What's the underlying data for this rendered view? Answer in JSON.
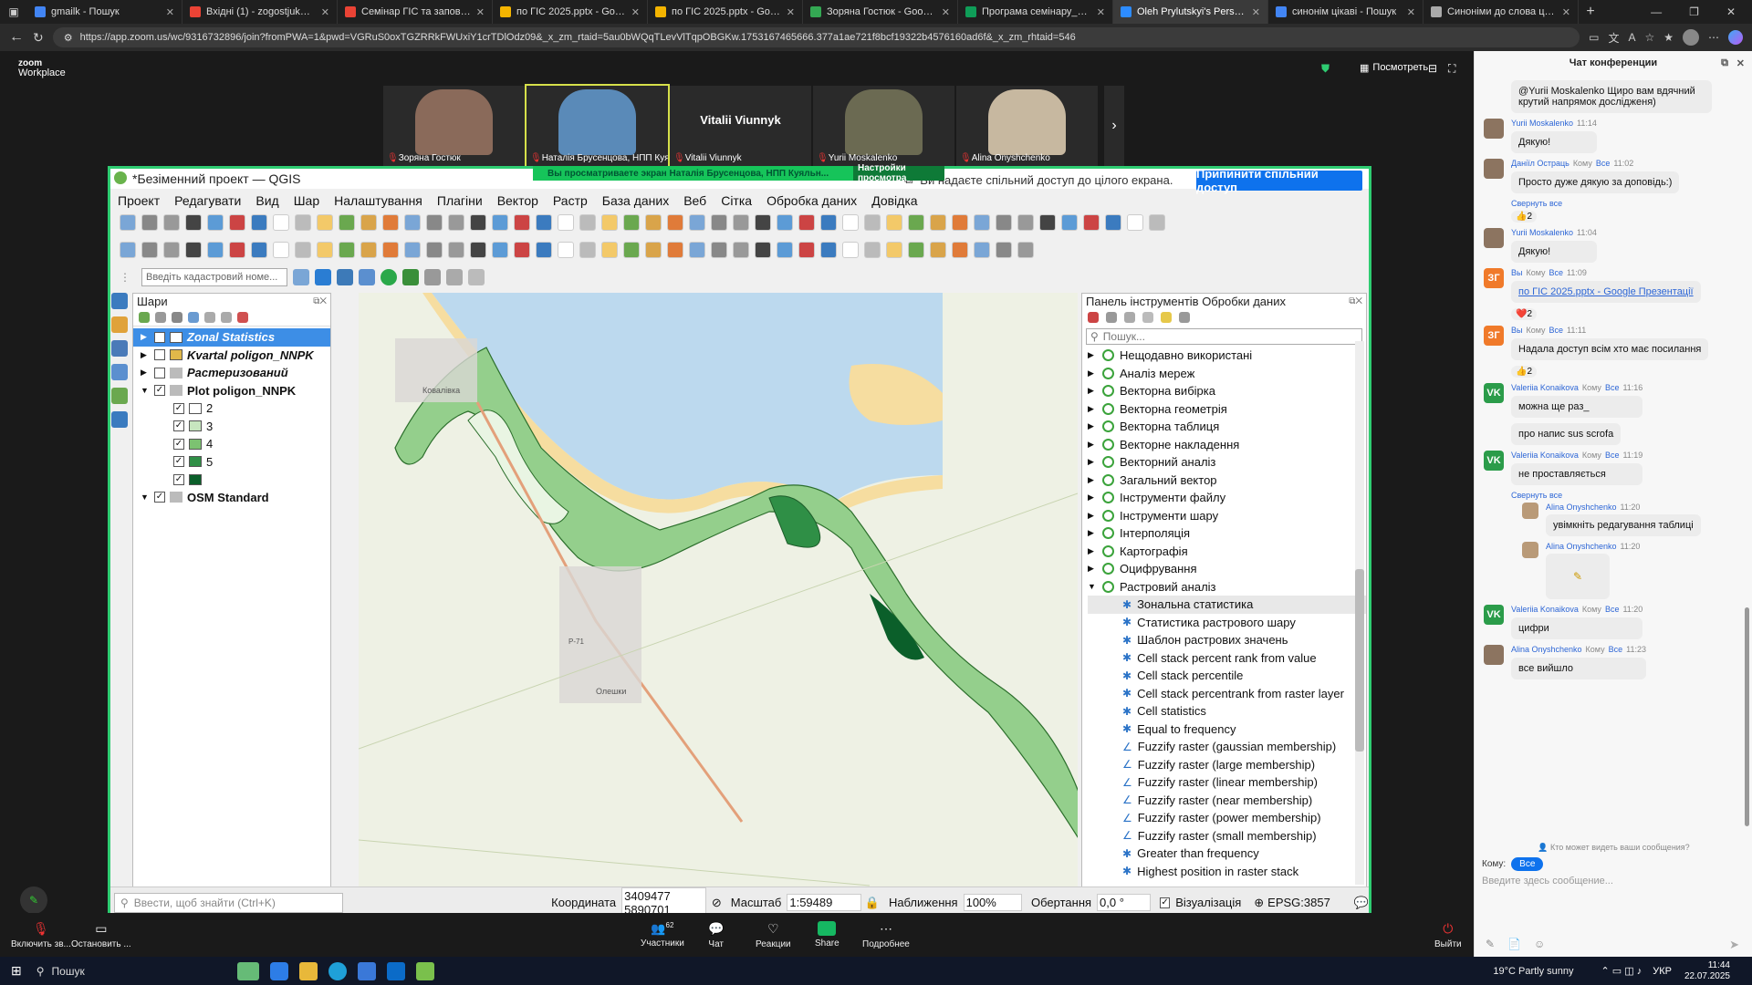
{
  "browser": {
    "tabs": [
      {
        "label": "gmailk - Пошук",
        "color": "#4285f4"
      },
      {
        "label": "Вхідні (1) - zogostjuk@gmail.co",
        "color": "#ea4335"
      },
      {
        "label": "Семінар ГІС та заповідні тери",
        "color": "#ea4335"
      },
      {
        "label": "по ГІС 2025.pptx - Google Пре",
        "color": "#f4b400"
      },
      {
        "label": "по ГІС 2025.pptx - Google Пре",
        "color": "#f4b400"
      },
      {
        "label": "Зоряна Гостюк - Google Диск",
        "color": "#34a853"
      },
      {
        "label": "Програма семінару_2025.xlsx",
        "color": "#0f9d58"
      },
      {
        "label": "Oleh Prylutskyi's Personal",
        "color": "#2d8cff",
        "active": true
      },
      {
        "label": "синонім цікаві - Пошук",
        "color": "#4285f4"
      },
      {
        "label": "Синоніми до слова цікавий в",
        "color": "#aaaaaa"
      }
    ],
    "url": "https://app.zoom.us/wc/9316732896/join?fromPWA=1&pwd=VGRuS0oxTGZRRkFWUxiY1crTDlOdz09&_x_zm_rtaid=5au0bWQqTLevVlTqpOBGKw.1753167465666.377a1ae721f8bcf19322b4576160ad6f&_x_zm_rhtaid=546"
  },
  "zoom": {
    "brand": [
      "zoom",
      "Workplace"
    ],
    "view_label": "Посмотреть",
    "participants": [
      {
        "name": "Зоряна Гостюк"
      },
      {
        "name": "Наталія Брусенцова, НПП Куяльн..."
      },
      {
        "name": "Vitalii Viunnyk",
        "center": "Vitalii Viunnyk"
      },
      {
        "name": "Yurii Moskalenko"
      },
      {
        "name": "Alina Onyshchenko"
      }
    ],
    "share_banner": "Вы просматриваете экран  Наталія Брусенцова, НПП Куяльн...",
    "share_settings": "Настройки просмотра",
    "screen_notice": "Ви надаєте спільний доступ до цілого екрана.",
    "stop_share": "Припинити спільний доступ",
    "bottom": {
      "mic": "Включить зв...",
      "video": "Остановить ...",
      "participants": "Участники",
      "participants_count": "62",
      "chat": "Чат",
      "reactions": "Реакции",
      "share": "Share",
      "more": "Подробнее",
      "leave": "Выйти"
    }
  },
  "qgis": {
    "title": "*Безіменний проект — QGIS",
    "menu": [
      "Проект",
      "Редагувати",
      "Вид",
      "Шар",
      "Налаштування",
      "Плагіни",
      "Вектор",
      "Растр",
      "База даних",
      "Веб",
      "Сітка",
      "Обробка даних",
      "Довідка"
    ],
    "cadastre_placeholder": "Введіть кадастровий номе...",
    "layers_title": "Шари",
    "layers": [
      {
        "name": "Zonal Statistics",
        "style": "bold-italic",
        "selected": true,
        "checked": false,
        "swatch": "#ffffff"
      },
      {
        "name": "Kvartal poligon_NNPK",
        "style": "bold-italic",
        "checked": false,
        "swatch": "#e0b84a"
      },
      {
        "name": "Растеризований",
        "style": "bold-italic",
        "checked": false,
        "swatch": ""
      },
      {
        "name": "Plot poligon_NNPK",
        "style": "bold",
        "checked": true,
        "swatch": ""
      },
      {
        "name": "2",
        "child": true,
        "checked": true,
        "swatch": "#ffffff"
      },
      {
        "name": "3",
        "child": true,
        "checked": true,
        "swatch": "#c7e6bf"
      },
      {
        "name": "4",
        "child": true,
        "checked": true,
        "swatch": "#7cc271"
      },
      {
        "name": "5",
        "child": true,
        "checked": true,
        "swatch": "#2f8f46"
      },
      {
        "name": "",
        "child": true,
        "checked": true,
        "swatch": "#0b5f2a"
      },
      {
        "name": "OSM Standard",
        "style": "bold",
        "checked": true,
        "swatch": ""
      }
    ],
    "processing_title": "Панель інструментів Обробки даних",
    "processing_search": "Пошук...",
    "groups": [
      "Нещодавно використані",
      "Аналіз мереж",
      "Векторна вибірка",
      "Векторна геометрія",
      "Векторна таблиця",
      "Векторне накладення",
      "Векторний аналіз",
      "Загальний вектор",
      "Інструменти файлу",
      "Інструменти шару",
      "Інтерполяція",
      "Картографія",
      "Оцифрування",
      "Растровий аналіз"
    ],
    "raster_tools": [
      "Зональна статистика",
      "Статистика растрового шару",
      "Шаблон растрових значень",
      "Cell stack percent rank from value",
      "Cell stack percentile",
      "Cell stack percentrank from raster layer",
      "Cell statistics",
      "Equal to frequency",
      "Fuzzify raster (gaussian membership)",
      "Fuzzify raster (large membership)",
      "Fuzzify raster (linear membership)",
      "Fuzzify raster (near membership)",
      "Fuzzify raster (power membership)",
      "Fuzzify raster (small membership)",
      "Greater than frequency",
      "Highest position in raster stack"
    ],
    "status": {
      "search_placeholder": "Ввести, щоб знайти (Ctrl+K)",
      "coord_label": "Координата",
      "coord": "3409477 5890701",
      "scale_label": "Масштаб",
      "scale": "1:59489",
      "zoom_label": "Наближення",
      "zoom": "100%",
      "rotation_label": "Обертання",
      "rotation": "0,0 °",
      "render_label": "Візуалізація",
      "crs": "EPSG:3857"
    },
    "map_labels": [
      "Ковалівка",
      "Р-71",
      "Олешки"
    ]
  },
  "chat": {
    "title": "Чат конференции",
    "messages": [
      {
        "type": "text-cont",
        "text": "@Yurii Moskalenko Щиро вам вдячний крутий напрямок дослідженя)"
      },
      {
        "type": "msg",
        "name": "Yurii Moskalenko",
        "time": "11:14",
        "text": "Дякую!",
        "avatar": "photo"
      },
      {
        "type": "msg",
        "name": "Даніїл Остраць",
        "to": "Кому",
        "to_who": "Все",
        "time": "11:02",
        "text": "Просто дуже дякую за доповідь:)",
        "avatar": "photo2"
      },
      {
        "type": "reaction",
        "collapse": "Свернуть все",
        "count": "2",
        "emoji": "👍"
      },
      {
        "type": "msg",
        "name": "Yurii Moskalenko",
        "time": "11:04",
        "text": "Дякую!",
        "avatar": "photo"
      },
      {
        "type": "msg",
        "name": "Вы",
        "to": "Кому",
        "to_who": "Все",
        "time": "11:09",
        "text": "по ГІС 2025.pptx - Google Презентації",
        "avatar": "ЗГ",
        "link": true
      },
      {
        "type": "reaction",
        "count": "2",
        "emoji": "❤️"
      },
      {
        "type": "msg",
        "name": "Вы",
        "to": "Кому",
        "to_who": "Все",
        "time": "11:11",
        "text": "Надала доступ всім хто має посилання",
        "avatar": "ЗГ"
      },
      {
        "type": "reaction",
        "count": "2",
        "emoji": "👍"
      },
      {
        "type": "msg",
        "name": "Valeriia Konaikova",
        "to": "Кому",
        "to_who": "Все",
        "time": "11:16",
        "text": "можна ще раз_",
        "avatar": "VK"
      },
      {
        "type": "text-cont",
        "text": "про напис sus scrofa"
      },
      {
        "type": "msg",
        "name": "Valeriia Konaikova",
        "to": "Кому",
        "to_who": "Все",
        "time": "11:19",
        "text": "не проставляється",
        "avatar": "VK"
      },
      {
        "type": "thread",
        "collapse": "Свернуть все",
        "name": "Alina Onyshchenko",
        "time": "11:20",
        "text": "увімкніть редагування таблиці"
      },
      {
        "type": "thread-img",
        "name": "Alina Onyshchenko",
        "time": "11:20"
      },
      {
        "type": "msg",
        "name": "Valeriia Konaikova",
        "to": "Кому",
        "to_who": "Все",
        "time": "11:20",
        "text": "цифри",
        "avatar": "VK"
      },
      {
        "type": "msg",
        "name": "Alina Onyshchenko",
        "to": "Кому",
        "to_who": "Все",
        "time": "11:23",
        "text": "все вийшло",
        "avatar": "photo3"
      }
    ],
    "who_sees": "Кто может видеть ваши сообщения?",
    "to_label": "Кому:",
    "to_value": "Все",
    "input_placeholder": "Введите здесь сообщение..."
  },
  "taskbar": {
    "search": "Пошук",
    "weather": "19°C  Partly sunny",
    "lang": "УКР",
    "time": "11:44",
    "date": "22.07.2025"
  }
}
